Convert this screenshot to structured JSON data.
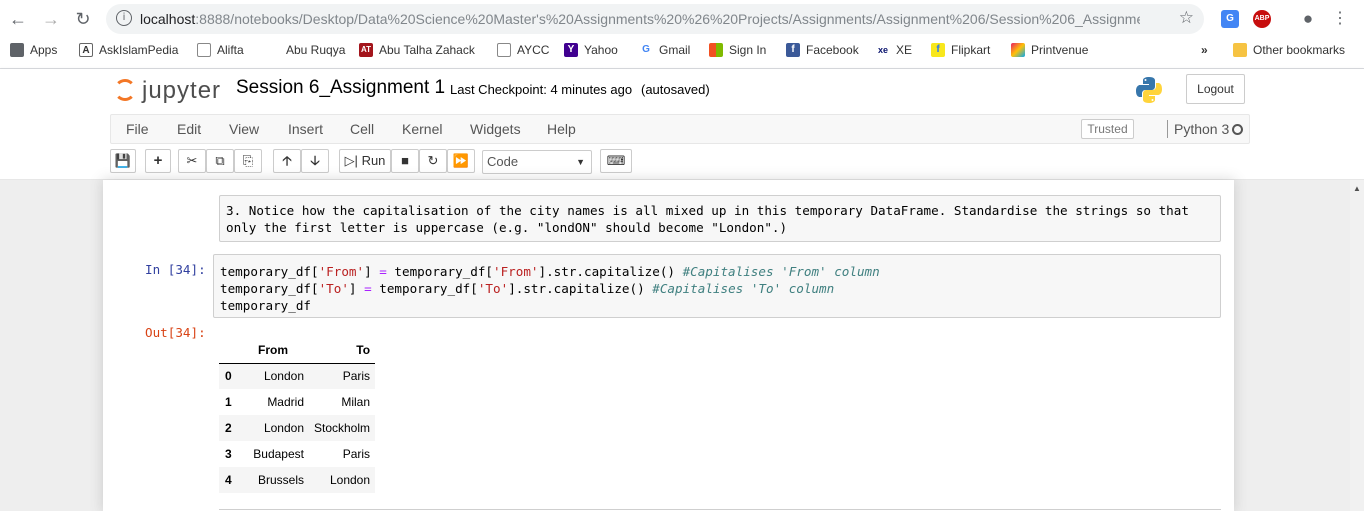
{
  "browser": {
    "url_host": "localhost",
    "url_rest": ":8888/notebooks/Desktop/Data%20Science%20Master's%20Assignments%20%26%20Projects/Assignments/Assignment%206/Session%206_Assignment%2...",
    "bookmarks": [
      "Apps",
      "AskIslamPedia",
      "Alifta",
      "Abu Ruqya",
      "Abu Talha Zahack",
      "AYCC",
      "Yahoo",
      "Gmail",
      "Sign In",
      "Facebook",
      "XE",
      "Flipkart",
      "Printvenue"
    ],
    "more_label": "»",
    "other_bookmarks": "Other bookmarks",
    "ext_translate": "G",
    "ext_abp": "ABP"
  },
  "notebook": {
    "logo_text": "jupyter",
    "title": "Session 6_Assignment 1",
    "checkpoint": "Last Checkpoint: 4 minutes ago",
    "autosaved": "(autosaved)",
    "logout": "Logout",
    "menu": [
      "File",
      "Edit",
      "View",
      "Insert",
      "Cell",
      "Kernel",
      "Widgets",
      "Help"
    ],
    "trusted": "Trusted",
    "kernel_name": "Python 3",
    "run_label": "Run",
    "cell_type": "Code"
  },
  "cells": {
    "markdown": "3. Notice how the capitalisation of the city names is all mixed up in this temporary DataFrame. Standardise the strings so that\nonly the first letter is uppercase (e.g. \"londON\" should become \"London\".)",
    "in_prompt": "In [34]:",
    "out_prompt": "Out[34]:",
    "code": {
      "line1_a": "temporary_df[",
      "line1_s1": "'From'",
      "line1_b": "] ",
      "line1_eq": "=",
      "line1_c": " temporary_df[",
      "line1_s2": "'From'",
      "line1_d": "].str.capitalize() ",
      "line1_cmt": "#Capitalises 'From' column",
      "line2_a": "temporary_df[",
      "line2_s1": "'To'",
      "line2_b": "] ",
      "line2_eq": "=",
      "line2_c": " temporary_df[",
      "line2_s2": "'To'",
      "line2_d": "].str.capitalize() ",
      "line2_cmt": "#Capitalises 'To' column",
      "line3": "temporary_df"
    },
    "table": {
      "columns": [
        "From",
        "To"
      ],
      "rows": [
        {
          "index": "0",
          "from": "London",
          "to": "Paris"
        },
        {
          "index": "1",
          "from": "Madrid",
          "to": "Milan"
        },
        {
          "index": "2",
          "from": "London",
          "to": "Stockholm"
        },
        {
          "index": "3",
          "from": "Budapest",
          "to": "Paris"
        },
        {
          "index": "4",
          "from": "Brussels",
          "to": "London"
        }
      ]
    }
  },
  "colors": {
    "jupyter_orange": "#f37726",
    "in_prompt": "#303f9f",
    "out_prompt": "#d84315"
  }
}
